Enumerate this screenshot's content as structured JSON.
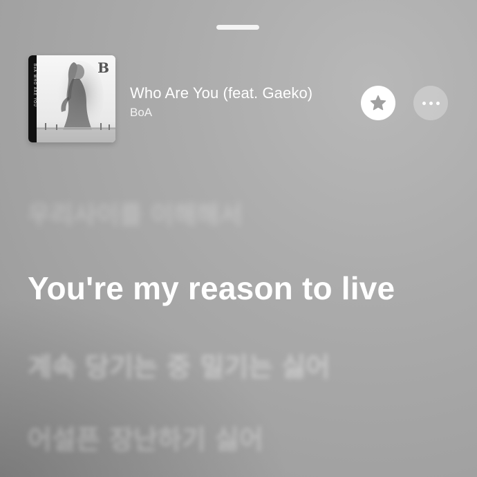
{
  "track": {
    "title": "Who Are You (feat. Gaeko)",
    "artist": "BoA",
    "artwork": {
      "description_icon": "album-art-image",
      "logo_text": "B",
      "spine_text": "BoA  WHO ARE YOU"
    }
  },
  "controls": {
    "grabber_icon": "grabber-handle",
    "favorite_icon": "star-icon",
    "more_icon": "ellipsis-icon"
  },
  "lyrics": {
    "previous": "우리사이를 이해해서",
    "current": "You're my reason to live",
    "next": [
      "계속 당기는 중 밀기는 싫어",
      "어설픈 장난하기 싫어"
    ]
  },
  "colors": {
    "background": "#a8a8a8",
    "foreground": "#ffffff",
    "star": "#a0a0a0"
  }
}
